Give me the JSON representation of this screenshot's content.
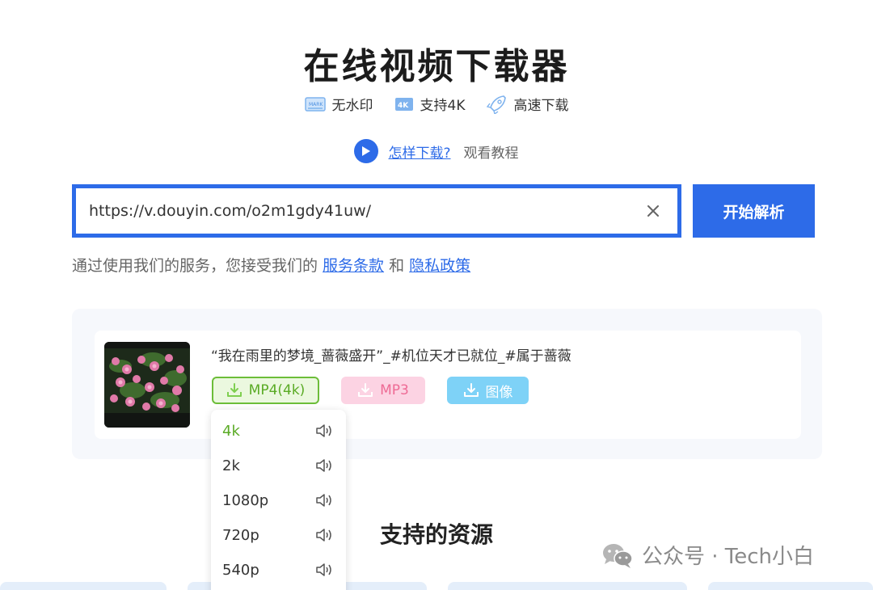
{
  "header": {
    "title": "在线视频下载器",
    "features": [
      {
        "label": "无水印",
        "icon": "no-watermark-icon"
      },
      {
        "label": "支持4K",
        "icon": "4k-badge-icon"
      },
      {
        "label": "高速下载",
        "icon": "rocket-icon"
      }
    ],
    "howto": {
      "link": "怎样下载? ",
      "watch": "观看教程"
    }
  },
  "search": {
    "value": "https://v.douyin.com/o2m1gdy41uw/",
    "parse_button": "开始解析"
  },
  "terms": {
    "prefix": "通过使用我们的服务，您接受我们的 ",
    "terms_link": "服务条款",
    "and": " 和 ",
    "privacy_link": "隐私政策"
  },
  "result": {
    "title": "“我在雨里的梦境_蔷薇盛开”_#机位天才已就位_#属于蔷薇",
    "buttons": {
      "mp4": "MP4(4k)",
      "mp3": "MP3",
      "image": "图像"
    },
    "qualities": [
      "4k",
      "2k",
      "1080p",
      "720p",
      "540p"
    ],
    "selected_quality": "4k"
  },
  "sections": {
    "supported": "支持的资源"
  },
  "watermark": {
    "text": "公众号 · Tech小白"
  },
  "colors": {
    "primary": "#2d6be8",
    "mp4_green": "#5aab25",
    "mp3_pink": "#ee6b95",
    "image_blue": "#7ed2f7"
  }
}
